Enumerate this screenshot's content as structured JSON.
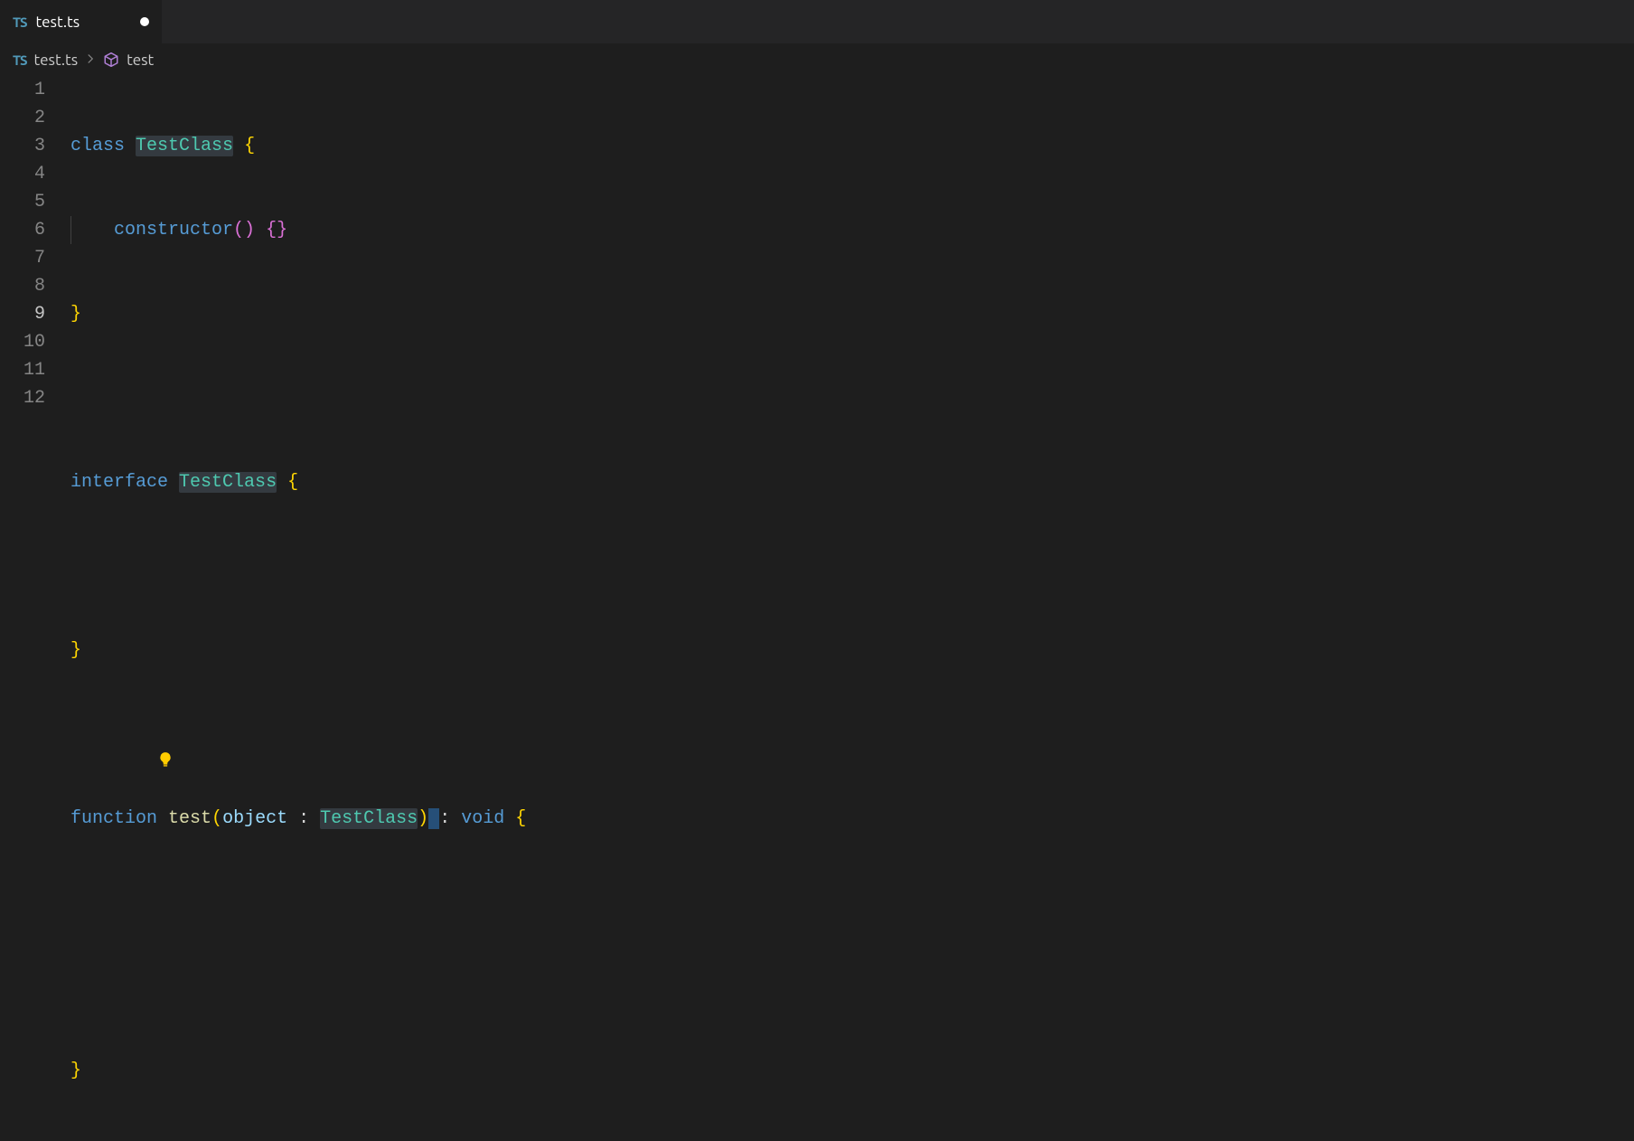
{
  "tab": {
    "icon_label": "TS",
    "filename": "test.ts",
    "dirty": true
  },
  "breadcrumb": {
    "icon_label": "TS",
    "file": "test.ts",
    "symbol": "test"
  },
  "editor": {
    "active_line": 9,
    "line_numbers": [
      "1",
      "2",
      "3",
      "4",
      "5",
      "6",
      "7",
      "8",
      "9",
      "10",
      "11",
      "12"
    ],
    "tokens": {
      "class_kw": "class",
      "interface_kw": "interface",
      "function_kw": "function",
      "constructor_kw": "constructor",
      "void_kw": "void",
      "test_class": "TestClass",
      "test_fn": "test",
      "object_param": "object",
      "open_brace": "{",
      "close_brace": "}",
      "open_paren": "(",
      "close_paren": ")",
      "colon": ":",
      "space": " ",
      "empty_braces": "{}",
      "empty_parens": "()"
    }
  }
}
